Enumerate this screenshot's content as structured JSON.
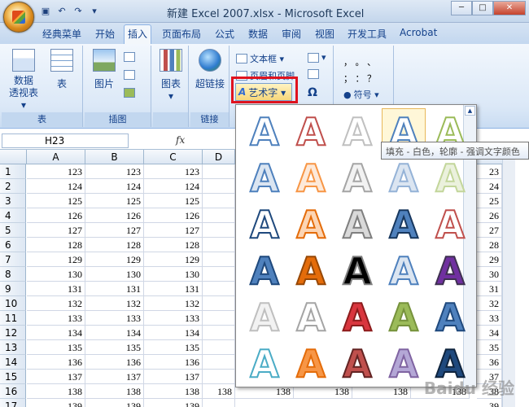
{
  "window": {
    "title": "新建 Excel 2007.xlsx - Microsoft Excel",
    "buttons": [
      "─",
      "□",
      "✕"
    ]
  },
  "quick_access": {
    "icons": [
      "save-icon",
      "undo-icon",
      "redo-icon",
      "customize-icon"
    ]
  },
  "tabs": [
    {
      "label": "经典菜单",
      "active": false
    },
    {
      "label": "开始",
      "active": false
    },
    {
      "label": "插入",
      "active": true
    },
    {
      "label": "页面布局",
      "active": false
    },
    {
      "label": "公式",
      "active": false
    },
    {
      "label": "数据",
      "active": false
    },
    {
      "label": "审阅",
      "active": false
    },
    {
      "label": "视图",
      "active": false
    },
    {
      "label": "开发工具",
      "active": false
    },
    {
      "label": "Acrobat",
      "active": false
    }
  ],
  "ribbon": {
    "groups": {
      "table": {
        "label": "表",
        "pivot_line1": "数据",
        "pivot_line2": "透视表 ▾",
        "table_btn": "表"
      },
      "illustrations": {
        "label": "插图",
        "picture": "图片"
      },
      "charts": {
        "label": "",
        "chart": "图表"
      },
      "links": {
        "label": "链接",
        "hyperlink": "超链接"
      },
      "text": {
        "textbox": "文本框 ▾",
        "header_footer": "页眉和页脚",
        "wordart": "艺术字 ▾",
        "omega": "Ω"
      },
      "symbols": {
        "row1": "，  。  、",
        "row2": "；  ：  ？",
        "symbol": "符号 ▾"
      }
    }
  },
  "formula_bar": {
    "name_box": "H23",
    "fx": "fx"
  },
  "tooltip": "填充 - 白色，轮廓 - 强调文字颜色",
  "sheet": {
    "columns": [
      "A",
      "B",
      "C",
      "D"
    ],
    "rows": [
      {
        "n": "1",
        "v": "123",
        "right": "23"
      },
      {
        "n": "2",
        "v": "124",
        "right": "24"
      },
      {
        "n": "3",
        "v": "125",
        "right": "25"
      },
      {
        "n": "4",
        "v": "126",
        "right": "26"
      },
      {
        "n": "5",
        "v": "127",
        "right": "27"
      },
      {
        "n": "6",
        "v": "128",
        "right": "28"
      },
      {
        "n": "7",
        "v": "129",
        "right": "29"
      },
      {
        "n": "8",
        "v": "130",
        "right": "30"
      },
      {
        "n": "9",
        "v": "131",
        "right": "31"
      },
      {
        "n": "10",
        "v": "132",
        "right": "32"
      },
      {
        "n": "11",
        "v": "133",
        "right": "33"
      },
      {
        "n": "12",
        "v": "134",
        "right": "34"
      },
      {
        "n": "13",
        "v": "135",
        "right": "35"
      },
      {
        "n": "14",
        "v": "136",
        "right": "36"
      },
      {
        "n": "15",
        "v": "137",
        "right": "37"
      },
      {
        "n": "16",
        "v": "138",
        "right": "38"
      },
      {
        "n": "17",
        "v": "139",
        "right": "39"
      }
    ],
    "row16_extra": [
      "138",
      "138",
      "138",
      "138",
      "138"
    ]
  },
  "wordart_gallery": {
    "glyph": "A",
    "styles": [
      {
        "fill": "#ffffff",
        "stroke": "#4f81bd"
      },
      {
        "fill": "#ffffff",
        "stroke": "#c0504d"
      },
      {
        "fill": "#ffffff",
        "stroke": "#c0c0c0"
      },
      {
        "fill": "#ffffff",
        "stroke": "#4f81bd"
      },
      {
        "fill": "#ffffff",
        "stroke": "#9bbb59"
      },
      {
        "fill": "#dbe5f1",
        "stroke": "#4f81bd"
      },
      {
        "fill": "#fde9d9",
        "stroke": "#f79646"
      },
      {
        "fill": "#f2f2f2",
        "stroke": "#a5a5a5"
      },
      {
        "fill": "#dbe5f1",
        "stroke": "#95b3d7"
      },
      {
        "fill": "#ebf1dd",
        "stroke": "#c3d69b"
      },
      {
        "fill": "#ffffff",
        "stroke": "#1f497d"
      },
      {
        "fill": "#fcd5b4",
        "stroke": "#e46c0a"
      },
      {
        "fill": "#d9d9d9",
        "stroke": "#7f7f7f"
      },
      {
        "fill": "#4f81bd",
        "stroke": "#17375e"
      },
      {
        "fill": "#ffffff",
        "stroke": "#c0504d"
      },
      {
        "fill": "#4f81bd",
        "stroke": "#1f497d"
      },
      {
        "fill": "#e46c0a",
        "stroke": "#974806"
      },
      {
        "fill": "#000000",
        "stroke": "#7f7f7f"
      },
      {
        "fill": "#dbe5f1",
        "stroke": "#4f81bd"
      },
      {
        "fill": "#7030a0",
        "stroke": "#3f3151"
      },
      {
        "fill": "#f2f2f2",
        "stroke": "#bfbfbf"
      },
      {
        "fill": "#ffffff",
        "stroke": "#a5a5a5"
      },
      {
        "fill": "#d9363e",
        "stroke": "#8c1c1c"
      },
      {
        "fill": "#9bbb59",
        "stroke": "#76923c"
      },
      {
        "fill": "#4f81bd",
        "stroke": "#1f497d"
      },
      {
        "fill": "#ffffff",
        "stroke": "#4bacc6"
      },
      {
        "fill": "#f79646",
        "stroke": "#e46c0a"
      },
      {
        "fill": "#c0504d",
        "stroke": "#632423"
      },
      {
        "fill": "#b4a7d6",
        "stroke": "#8064a2"
      },
      {
        "fill": "#1f497d",
        "stroke": "#0f243e"
      }
    ]
  },
  "watermark": "Baidu 经验"
}
